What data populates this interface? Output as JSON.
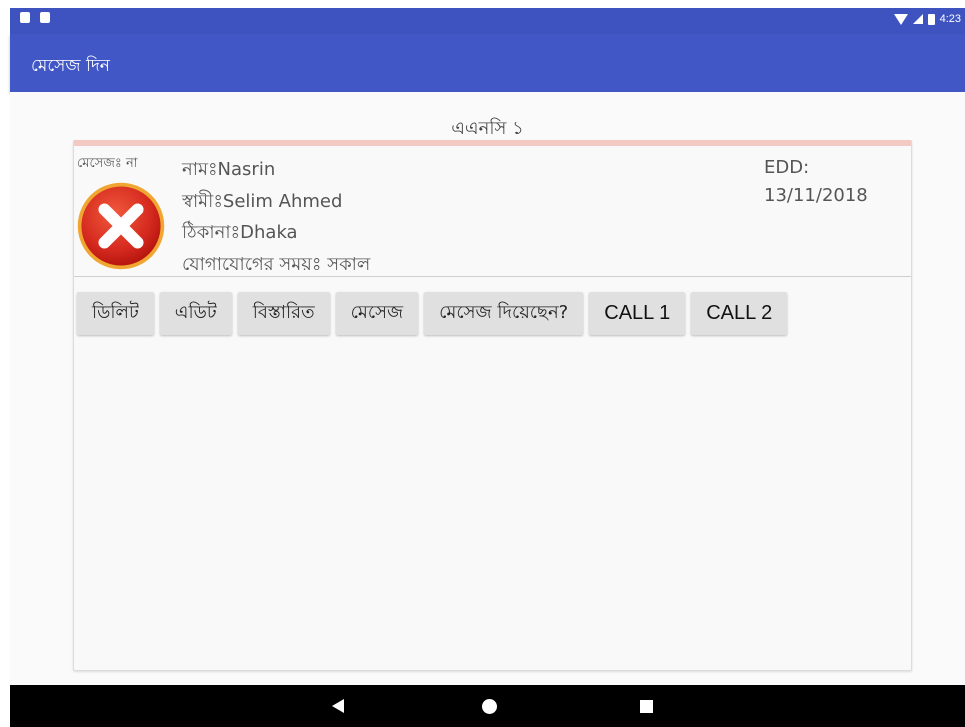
{
  "status_bar": {
    "time": "4:23",
    "left_icons": [
      "sd-card-icon",
      "notification-icon"
    ],
    "right_icons": [
      "wifi-icon",
      "signal-icon",
      "battery-icon"
    ]
  },
  "app_bar": {
    "title": "মেসেজ দিন"
  },
  "section": {
    "title": "এএনসি ১"
  },
  "patient": {
    "message_status": "মেসেজঃ না",
    "status_icon": "red-x-circle-icon",
    "name": "নামঃNasrin",
    "husband": "স্বামীঃSelim Ahmed",
    "address": "ঠিকানাঃDhaka",
    "contact_time": "যোগাযোগের সময়ঃ সকাল",
    "edd_label": "EDD:",
    "edd_value": "13/11/2018"
  },
  "buttons": {
    "delete": "ডিলিট",
    "edit": "এডিট",
    "details": "বিস্তারিত",
    "message": "মেসেজ",
    "message_sent": "মেসেজ দিয়েছেন?",
    "call1": "CALL 1",
    "call2": "CALL 2"
  },
  "nav_bar": {
    "icons": [
      "back-icon",
      "home-icon",
      "recents-icon"
    ]
  },
  "colors": {
    "app_bar": "#4257c6",
    "status_bar": "#3f53c0",
    "card_top_accent": "#f2c9c3",
    "button_bg": "#e0e0e0",
    "x_icon_red": "#d92a22"
  }
}
